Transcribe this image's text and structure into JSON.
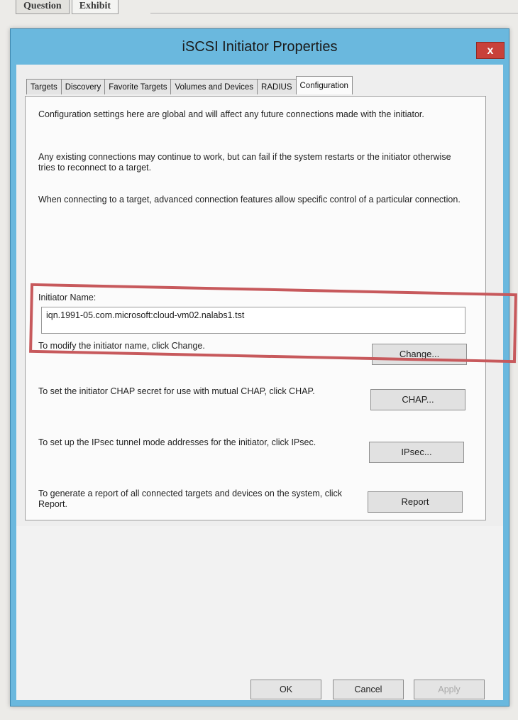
{
  "outer": {
    "tabs": [
      "Question",
      "Exhibit"
    ]
  },
  "window": {
    "title": "iSCSI Initiator Properties",
    "close": "x"
  },
  "tabs": [
    "Targets",
    "Discovery",
    "Favorite Targets",
    "Volumes and Devices",
    "RADIUS",
    "Configuration"
  ],
  "config": {
    "para1": "Configuration settings here are global and will affect any future connections made with the initiator.",
    "para2": "Any existing connections may continue to work, but can fail if the system restarts or the initiator otherwise tries to reconnect to a target.",
    "para3": "When connecting to a target, advanced connection features allow specific control of a particular connection.",
    "initiator_label": "Initiator Name:",
    "initiator_value": "iqn.1991-05.com.microsoft:cloud-vm02.nalabs1.tst",
    "change_text": "To modify the initiator name, click Change.",
    "change_button": "Change...",
    "chap_text": "To set the initiator CHAP secret for use with mutual CHAP, click CHAP.",
    "chap_button": "CHAP...",
    "ipsec_text": "To set up the IPsec tunnel mode addresses for the initiator, click IPsec.",
    "ipsec_button": "IPsec...",
    "report_text": "To generate a report of all connected targets and devices on the system, click Report.",
    "report_button": "Report"
  },
  "footer": {
    "ok": "OK",
    "cancel": "Cancel",
    "apply": "Apply"
  },
  "colors": {
    "window_frame": "#6ab8de",
    "close_button": "#c8413a",
    "highlight_box": "#c7595c"
  }
}
